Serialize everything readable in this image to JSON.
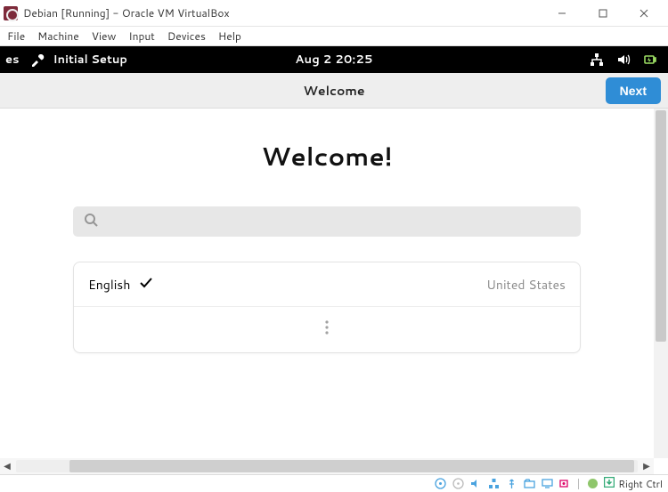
{
  "host": {
    "title": "Debian [Running] - Oracle VM VirtualBox",
    "menu": {
      "file": "File",
      "machine": "Machine",
      "view": "View",
      "input": "Input",
      "devices": "Devices",
      "help": "Help"
    },
    "status": {
      "hostkey_label": "Right Ctrl"
    }
  },
  "gnome_top": {
    "left_partial": "es",
    "setup_label": "Initial Setup",
    "clock": "Aug 2  20:25"
  },
  "header": {
    "title": "Welcome",
    "next_label": "Next"
  },
  "content": {
    "heading": "Welcome!",
    "search_placeholder": "",
    "language": {
      "name": "English",
      "region": "United States"
    }
  }
}
